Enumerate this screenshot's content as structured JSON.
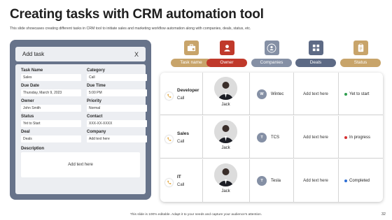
{
  "title": "Creating tasks with CRM automation tool",
  "subtitle": "This slide showcases creating different tasks in CRM tool to initiate sales and marketing workflow automation along with companies, deals, status, etc.",
  "task_card": {
    "header": "Add task",
    "close_glyph": "X",
    "fields": [
      {
        "label": "Task Name",
        "value": "Sales"
      },
      {
        "label": "Category",
        "value": "Call"
      },
      {
        "label": "Due Date",
        "value": "Thursday, March 9, 2023"
      },
      {
        "label": "Due Time",
        "value": "5:00 PM"
      },
      {
        "label": "Owner",
        "value": "John Smith"
      },
      {
        "label": "Priority",
        "value": "Normal"
      },
      {
        "label": "Status",
        "value": "Yet to Start"
      },
      {
        "label": "Contact",
        "value": "XXX-XX-XXXX"
      },
      {
        "label": "Deal",
        "value": "Deals"
      },
      {
        "label": "Company",
        "value": "Add text here"
      }
    ],
    "description_label": "Description",
    "description_value": "Add text here"
  },
  "columns": [
    {
      "label": "Task name",
      "color": "#c8a46a",
      "icon": "briefcase-icon"
    },
    {
      "label": "Owner",
      "color": "#c0392b",
      "icon": "person-icon"
    },
    {
      "label": "Companies",
      "color": "#8590a5",
      "icon": "people-icon"
    },
    {
      "label": "Deals",
      "color": "#5d6a85",
      "icon": "grid-icon"
    },
    {
      "label": "Status",
      "color": "#c8a46a",
      "icon": "clipboard-icon"
    }
  ],
  "rows": [
    {
      "title": "Developer",
      "type": "Call",
      "owner": "Jack",
      "company_initial": "W",
      "company": "Wintec",
      "deal": "Add text here",
      "status": "Yet to start",
      "status_color": "#2e9e4f"
    },
    {
      "title": "Sales",
      "type": "Call",
      "owner": "Jack",
      "company_initial": "T",
      "company": "TCS",
      "deal": "Add text here",
      "status": "In progress",
      "status_color": "#d63031"
    },
    {
      "title": "IT",
      "type": "Call",
      "owner": "Jack",
      "company_initial": "T",
      "company": "Tesla",
      "deal": "Add text here",
      "status": "Completed",
      "status_color": "#2f6fd6"
    }
  ],
  "footer": "This slide is 100% editable. Adapt it to your needs and capture your audience's attention.",
  "page_number": "32"
}
